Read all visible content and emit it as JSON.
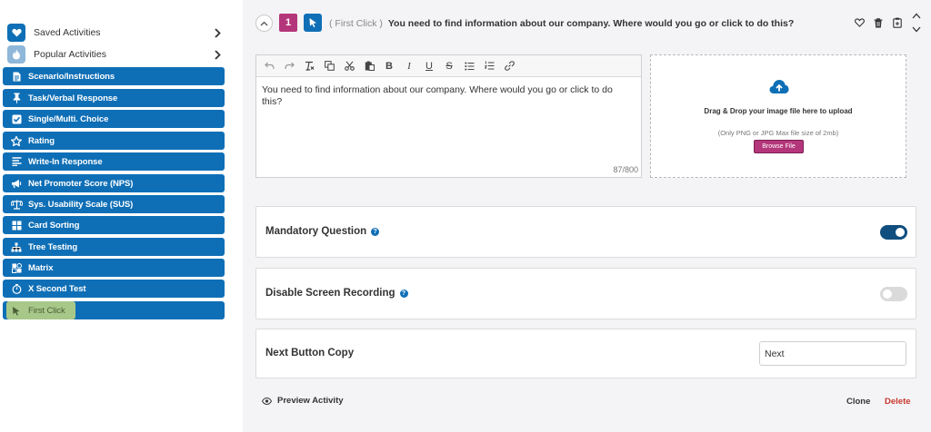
{
  "sidebar": {
    "saved_label": "Saved Activities",
    "popular_label": "Popular Activities",
    "activities": [
      {
        "label": "Scenario/Instructions",
        "icon": "document-icon"
      },
      {
        "label": "Task/Verbal Response",
        "icon": "pin-icon"
      },
      {
        "label": "Single/Multi. Choice",
        "icon": "checkbox-icon"
      },
      {
        "label": "Rating",
        "icon": "star-icon"
      },
      {
        "label": "Write-In Response",
        "icon": "lines-icon"
      },
      {
        "label": "Net Promoter Score (NPS)",
        "icon": "megaphone-icon"
      },
      {
        "label": "Sys. Usability Scale (SUS)",
        "icon": "scale-icon"
      },
      {
        "label": "Card Sorting",
        "icon": "grid-icon"
      },
      {
        "label": "Tree Testing",
        "icon": "tree-icon"
      },
      {
        "label": "Matrix",
        "icon": "matrix-icon"
      },
      {
        "label": "X Second Test",
        "icon": "timer-icon"
      },
      {
        "label": "First Click",
        "icon": "cursor-icon"
      }
    ],
    "selected_activity": "First Click"
  },
  "question": {
    "number": "1",
    "type_tag": "( First Click )",
    "title": "You need to find information about our company. Where would you go or click to do this?"
  },
  "editor": {
    "text": "You need to find information about our company. Where would you go or click to do this?",
    "char_count": "87/800"
  },
  "upload": {
    "title": "Drag & Drop your image file here to upload",
    "hint": "(Only PNG or JPG Max file size of 2mb)",
    "browse_label": "Browse File"
  },
  "settings": {
    "mandatory_label": "Mandatory Question",
    "mandatory_on": true,
    "disable_recording_label": "Disable Screen Recording",
    "disable_recording_on": false,
    "next_button_label": "Next Button Copy",
    "next_button_value": "Next"
  },
  "footer": {
    "preview_label": "Preview Activity",
    "clone_label": "Clone",
    "delete_label": "Delete"
  },
  "colors": {
    "activity_blue": "#0f6fb6",
    "question_magenta": "#b4367a",
    "toggle_on": "#0f4e7e",
    "delete_red": "#c8372d",
    "selected_highlight": "#a8c88a"
  }
}
